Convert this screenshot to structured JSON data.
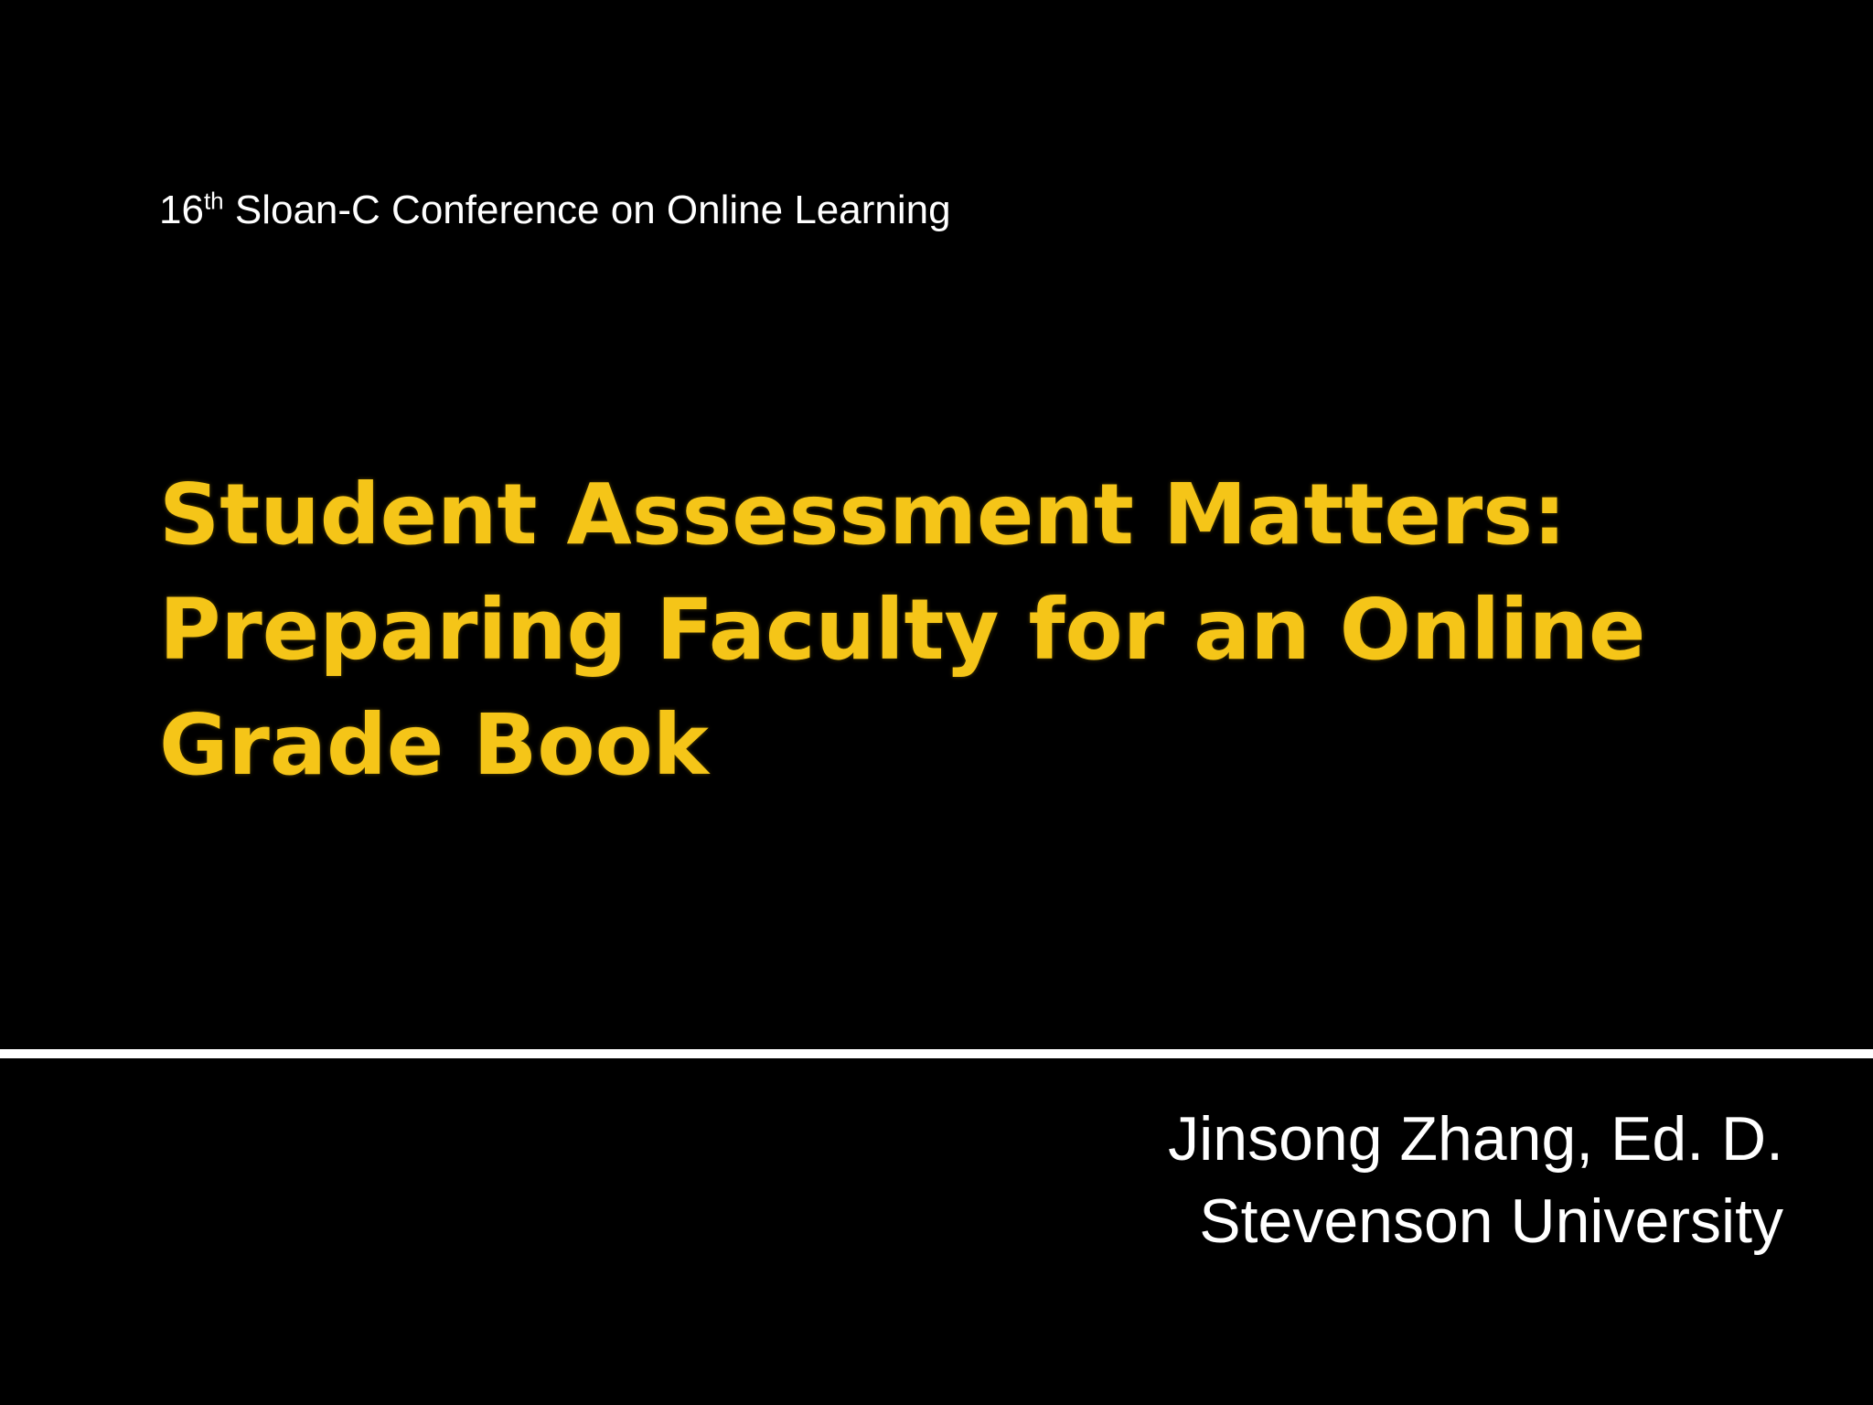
{
  "slide": {
    "background_color": "#000000",
    "title_color": "#f5c518",
    "text_color": "#ffffff",
    "divider_color": "#ffffff",
    "conference": {
      "ordinal_number": "16",
      "ordinal_suffix": "th",
      "name": " Sloan-C Conference on Online Learning"
    },
    "title_lines": [
      "Student Assessment Matters:",
      "Preparing Faculty for an Online",
      "Grade Book"
    ],
    "author": {
      "name": "Jinsong Zhang, Ed. D.",
      "institution": "Stevenson University"
    }
  }
}
